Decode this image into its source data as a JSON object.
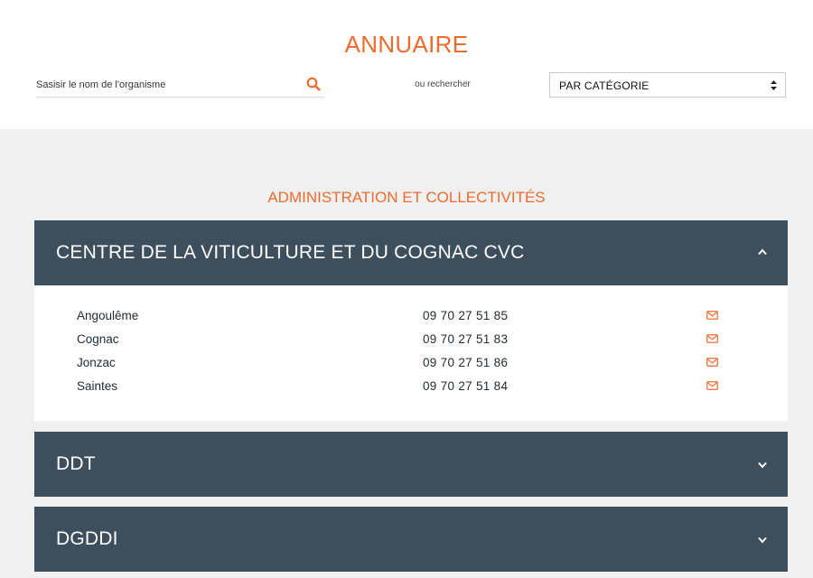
{
  "page": {
    "title": "ANNUAIRE",
    "search_placeholder": "Sasisir le nom de l'organisme",
    "or_label": "ou rechercher",
    "category_select": "PAR CATÉGORIE"
  },
  "section": {
    "title": "ADMINISTRATION ET COLLECTIVITÉS"
  },
  "organisms": [
    {
      "name": "CENTRE DE LA VITICULTURE ET DU COGNAC CVC",
      "expanded": true,
      "contacts": [
        {
          "city": "Angoulême",
          "phone": "09 70 27 51 85"
        },
        {
          "city": "Cognac",
          "phone": "09 70 27 51 83"
        },
        {
          "city": "Jonzac",
          "phone": "09 70 27 51 86"
        },
        {
          "city": "Saintes",
          "phone": "09 70 27 51 84"
        }
      ]
    },
    {
      "name": "DDT",
      "expanded": false
    },
    {
      "name": "DGDDI",
      "expanded": false
    }
  ],
  "icons": {
    "search": "search-icon",
    "select_arrows": "sort-arrows-icon",
    "expanded": "chevron-up-icon",
    "collapsed": "chevron-down-icon",
    "email": "envelope-icon"
  },
  "colors": {
    "accent": "#ee6b2e",
    "header_bg": "#3d4e5c",
    "section_bg": "#f0f0f0"
  }
}
